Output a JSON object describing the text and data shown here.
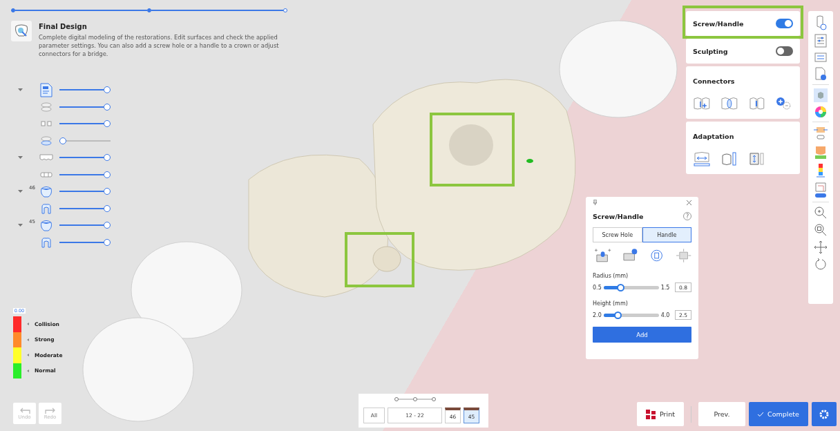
{
  "progress": {
    "steps": [
      {
        "done": true
      },
      {
        "done": true
      },
      {
        "done": false
      }
    ]
  },
  "step": {
    "title": "Final Design",
    "description": "Complete digital modeling of the restorations. Edit surfaces and check the applied parameter settings. You can also add a screw hole or a handle to a crown or adjust connectors for a bridge."
  },
  "layers": [
    {
      "kind": "document",
      "expanded": true,
      "level": 1,
      "children": [
        {
          "kind": "arch",
          "level": 1
        },
        {
          "kind": "pair",
          "level": 1
        },
        {
          "kind": "arch-base",
          "level": 0
        }
      ]
    },
    {
      "kind": "bridge",
      "expanded": true,
      "level": 1,
      "children": [
        {
          "kind": "row",
          "level": 1
        }
      ]
    },
    {
      "kind": "crown",
      "label": "46",
      "expanded": true,
      "level": 1,
      "children": [
        {
          "kind": "coping",
          "level": 1
        }
      ]
    },
    {
      "kind": "crown",
      "label": "45",
      "expanded": true,
      "level": 1,
      "children": [
        {
          "kind": "coping",
          "level": 1
        }
      ]
    }
  ],
  "legend": {
    "scale": "0.00",
    "items": [
      {
        "label": "Collision",
        "color": "#ff2a2a"
      },
      {
        "label": "Strong",
        "color": "#ff8a2a"
      },
      {
        "label": "Moderate",
        "color": "#ffff2a"
      },
      {
        "label": "Normal",
        "color": "#2aee2a"
      }
    ]
  },
  "history": [
    {
      "kind": "undo",
      "label": "Undo",
      "disabled": true
    },
    {
      "kind": "redo",
      "label": "Redo",
      "disabled": true
    }
  ],
  "toggles": [
    {
      "label": "Screw/Handle",
      "on": true,
      "highlighted": true
    },
    {
      "label": "Sculpting",
      "on": false,
      "highlighted": false
    }
  ],
  "tool_groups": [
    {
      "title": "Connectors",
      "tools": [
        {
          "kind": "connector-add"
        },
        {
          "kind": "connector-edit"
        },
        {
          "kind": "connector-shape"
        },
        {
          "kind": "connector-plus-minus"
        }
      ]
    },
    {
      "title": "Adaptation",
      "tools": [
        {
          "kind": "adapt-width"
        },
        {
          "kind": "adapt-height"
        },
        {
          "kind": "adapt-depth"
        }
      ]
    }
  ],
  "popup": {
    "title": "Screw/Handle",
    "help": "?",
    "tabs": [
      {
        "label": "Screw Hole",
        "selected": false
      },
      {
        "label": "Handle",
        "selected": true
      }
    ],
    "sliders": [
      {
        "label": "Radius (mm)",
        "min": "0.5",
        "max": "1.5",
        "value": "0.8",
        "level": 0.3
      },
      {
        "label": "Height (mm)",
        "min": "2.0",
        "max": "4.0",
        "value": "2.5",
        "level": 0.25
      }
    ],
    "button": "Add"
  },
  "filter": {
    "all": "All",
    "range": "12 - 22",
    "teeth": [
      {
        "label": "46",
        "selected": false
      },
      {
        "label": "45",
        "selected": true
      }
    ]
  },
  "actions": {
    "print": "Print",
    "prev": "Prev.",
    "complete": "Complete"
  }
}
